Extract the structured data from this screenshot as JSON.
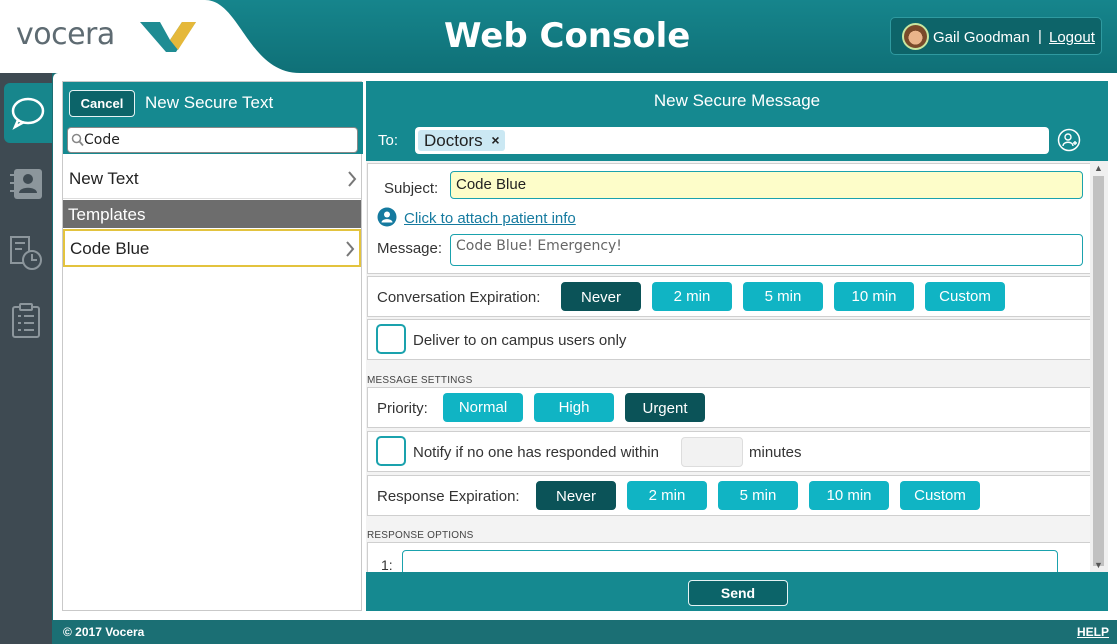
{
  "header": {
    "logo_text": "vocera",
    "title": "Web Console",
    "user_name": "Gail Goodman",
    "separator": "|",
    "logout_label": "Logout"
  },
  "sidenav": {
    "items": [
      {
        "icon": "chat-bubbles-icon",
        "active": true
      },
      {
        "icon": "contacts-book-icon",
        "active": false
      },
      {
        "icon": "history-clock-icon",
        "active": false
      },
      {
        "icon": "clipboard-checklist-icon",
        "active": false
      }
    ]
  },
  "left_panel": {
    "cancel_label": "Cancel",
    "title": "New Secure Text",
    "search_value": "Code",
    "new_text_label": "New Text",
    "templates_header": "Templates",
    "template_items": [
      "Code Blue"
    ]
  },
  "compose": {
    "title": "New Secure Message",
    "to_label": "To:",
    "recipients": [
      "Doctors"
    ],
    "subject_label": "Subject:",
    "subject_value": "Code Blue",
    "attach_link": "Click to attach patient info",
    "message_label": "Message:",
    "message_value": "Code Blue! Emergency!",
    "conversation_expiration": {
      "label": "Conversation Expiration:",
      "options": [
        "Never",
        "2 min",
        "5 min",
        "10 min",
        "Custom"
      ],
      "selected": "Never"
    },
    "campus_only_label": "Deliver to on campus users only",
    "message_settings_header": "MESSAGE SETTINGS",
    "priority": {
      "label": "Priority:",
      "options": [
        "Normal",
        "High",
        "Urgent"
      ],
      "selected": "Urgent"
    },
    "notify": {
      "label": "Notify if no one has responded within",
      "value": "",
      "unit": "minutes"
    },
    "response_expiration": {
      "label": "Response Expiration:",
      "options": [
        "Never",
        "2 min",
        "5 min",
        "10 min",
        "Custom"
      ],
      "selected": "Never"
    },
    "response_options_header": "RESPONSE OPTIONS",
    "response_option_number": "1:",
    "send_label": "Send"
  },
  "footer": {
    "copyright": "© 2017 Vocera",
    "help_label": "HELP"
  },
  "colors": {
    "teal_header": "#158990",
    "toggle_button": "#10b4c4",
    "toggle_selected": "#0b5358",
    "subject_highlight": "#fdfdc9",
    "selected_template_border": "#e3c33e",
    "sidenav_bg": "#3e4a52"
  }
}
